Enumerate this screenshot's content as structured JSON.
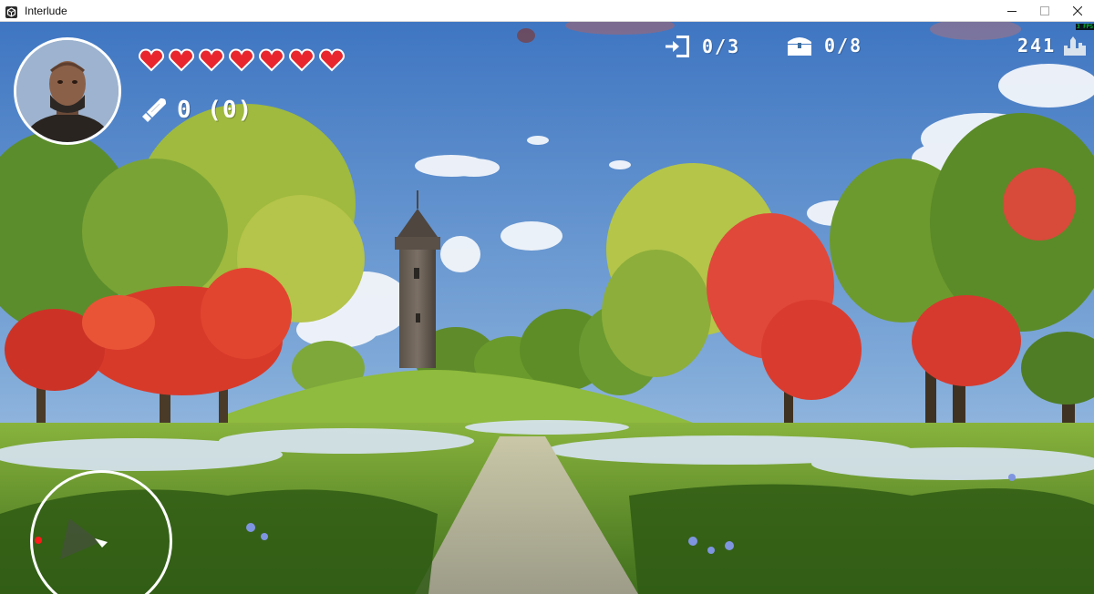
{
  "window": {
    "title": "Interlude",
    "app_icon": "unity-icon",
    "controls": [
      "minimize-icon",
      "maximize-icon",
      "close-icon"
    ]
  },
  "hud": {
    "hearts": {
      "count": 7,
      "color": "#e8262e",
      "icon": "heart-icon"
    },
    "ammo": {
      "icon": "bullet-icon",
      "text": "0 (0)"
    },
    "exits": {
      "icon": "exit-door-icon",
      "text": "0/3"
    },
    "chests": {
      "icon": "treasure-chest-icon",
      "text": "0/8"
    },
    "score": {
      "icon": "castle-icon",
      "text": "241"
    },
    "fps": "3 FPS",
    "minimap": {
      "player_icon": "player-arrow-icon",
      "objective_icon": "red-dot-icon",
      "objective_color": "#ff1a1a"
    }
  },
  "colors": {
    "sky_top": "#4a7fc8",
    "sky_bottom": "#a9c8e6",
    "grass": "#6e9b2e",
    "flowers": "#d8e6ff",
    "red_trees": "#e03a2e"
  }
}
